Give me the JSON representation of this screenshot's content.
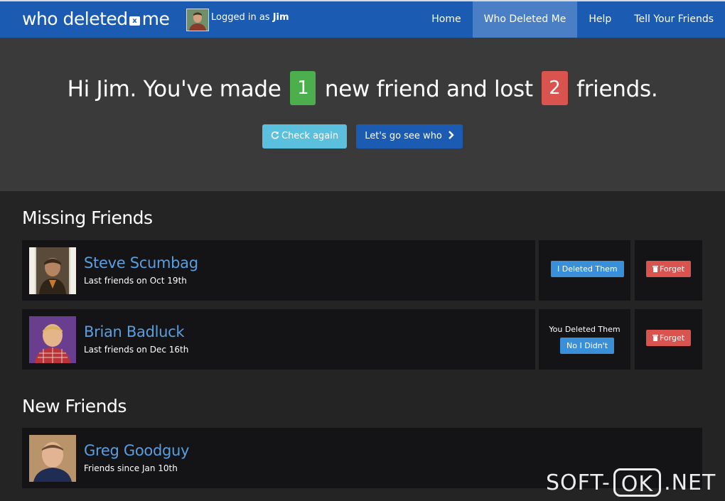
{
  "navbar": {
    "brand_left": "who deleted",
    "brand_x": "x",
    "brand_right": "me",
    "logged_prefix": "Logged in as",
    "user": "Jim",
    "links": [
      "Home",
      "Who Deleted Me",
      "Help",
      "Tell Your Friends"
    ],
    "active": "Who Deleted Me"
  },
  "hero": {
    "part1": "Hi Jim. You've made",
    "new_count": "1",
    "part2": "new friend and lost",
    "lost_count": "2",
    "part3": "friends.",
    "check_again": "Check again",
    "lets_go": "Let's go see who"
  },
  "missing": {
    "title": "Missing Friends",
    "items": [
      {
        "name": "Steve Scumbag",
        "sub": "Last friends on Oct 19th",
        "action_label": "",
        "action_button": "I Deleted Them",
        "forget": "Forget"
      },
      {
        "name": "Brian Badluck",
        "sub": "Last friends on Dec 16th",
        "action_label": "You Deleted Them",
        "action_button": "No I Didn't",
        "forget": "Forget"
      }
    ]
  },
  "new_friends": {
    "title": "New Friends",
    "items": [
      {
        "name": "Greg Goodguy",
        "sub": "Friends since Jan 10th"
      }
    ]
  },
  "watermark": {
    "left": "SOFT-",
    "box": "OK",
    "right": ".NET"
  },
  "colors": {
    "navbar": "#1b5bb1",
    "active_nav": "#4a7fc6",
    "green_badge": "#4cae4c",
    "red_badge": "#d9534f",
    "link": "#5b9ee0",
    "info_button": "#5bc0de"
  }
}
